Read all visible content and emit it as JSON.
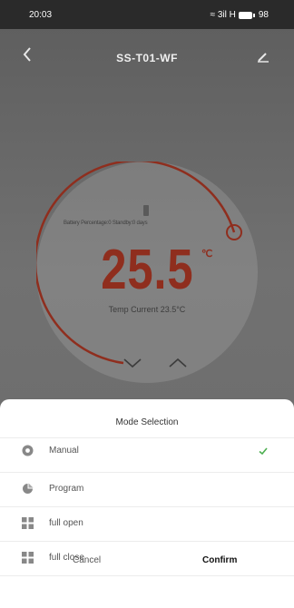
{
  "status_bar": {
    "time": "20:03",
    "signal": "≈ 3il H",
    "battery": "98"
  },
  "header": {
    "title": "SS-T01-WF"
  },
  "thermostat": {
    "battery_text": "Battery Percentage:0 Standby:0 days",
    "temperature": "25.5",
    "unit": "℃",
    "current_label": "Temp Current 23.5°C",
    "accent_color": "#8f2e1e",
    "dial_fill_fraction": 0.7
  },
  "sheet": {
    "title": "Mode Selection",
    "modes": [
      {
        "label": "Manual",
        "icon": "manual-icon",
        "selected": true
      },
      {
        "label": "Program",
        "icon": "program-icon",
        "selected": false
      },
      {
        "label": "full open",
        "icon": "grid-icon",
        "selected": false
      },
      {
        "label": "full close",
        "icon": "grid-icon",
        "selected": false
      }
    ],
    "cancel_label": "Cancel",
    "confirm_label": "Confirm",
    "check_color": "#4caf50"
  }
}
